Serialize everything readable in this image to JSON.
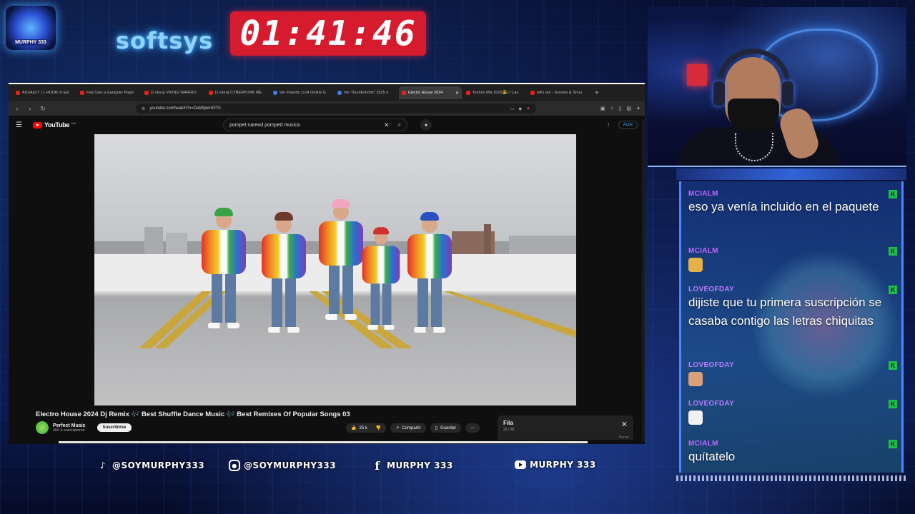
{
  "overlay": {
    "timer": "01:41:46",
    "neon_sign": "softsys",
    "logo_label": "MURPHY 333"
  },
  "browser": {
    "tabs": [
      {
        "title": "ASSAULT | 1 HOUR of Epi",
        "icon": "youtube-favicon"
      },
      {
        "title": "Feel Like a Gangster Playli",
        "icon": "youtube-favicon"
      },
      {
        "title": "[1 Hora] VIKING WARRIO",
        "icon": "youtube-favicon"
      },
      {
        "title": "[1 Hora] CYBERPUNK ME",
        "icon": "youtube-favicon"
      },
      {
        "title": "Ver Friends 1x14 Online G",
        "icon": "web-favicon"
      },
      {
        "title": "Ver Thunderbolts* 2025 o",
        "icon": "web-favicon"
      },
      {
        "title": "Electro House 2024",
        "icon": "youtube-favicon",
        "active": true
      },
      {
        "title": "Techno Mix 2025😎🎶Las",
        "icon": "youtube-favicon"
      },
      {
        "title": "will.i.am - Scream & Shou",
        "icon": "youtube-favicon"
      }
    ],
    "url": "youtube.com/watch?v=DaWljwmPiT0"
  },
  "youtube": {
    "logo_text": "YouTube",
    "logo_country": "MX",
    "search_query": "pompet nareod pomped musica",
    "signin_label": "Acce",
    "video_title": "Electro House 2024 Dj Remix 🎶 Best Shuffle Dance Music 🎶 Best Remixes Of Popular Songs 03",
    "channel_name": "Perfect Music",
    "channel_subs": "300 k suscriptores",
    "subscribe_label": "Suscribirse",
    "likes": "25 k",
    "share_label": "Compartir",
    "save_label": "Guardar",
    "queue_title": "Fila",
    "queue_count": "22 / 26",
    "queue_remove": "Borrar"
  },
  "chat": {
    "messages": [
      {
        "user": "MCIALM",
        "user_color": "#c066ff",
        "text": "eso ya venía incluido en el paquete"
      },
      {
        "user": "MCIALM",
        "user_color": "#c066ff",
        "emote": "laughing-face-emote"
      },
      {
        "user": "LOVEOFDAY",
        "user_color": "#b77cff",
        "text": "dijiste que tu primera suscripción se casaba contigo las letras chiquitas"
      },
      {
        "user": "LOVEOFDAY",
        "user_color": "#b77cff",
        "emote": "hand-emote"
      },
      {
        "user": "LOVEOFDAY",
        "user_color": "#b77cff",
        "emote": "skull-emote"
      },
      {
        "user": "MCIALM",
        "user_color": "#c066ff",
        "text": "quítatelo"
      }
    ]
  },
  "socials": {
    "tiktok": "@SOYMURPHY333",
    "instagram": "@SOYMURPHY333",
    "facebook": "MURPHY 333",
    "youtube": "MURPHY 333"
  }
}
